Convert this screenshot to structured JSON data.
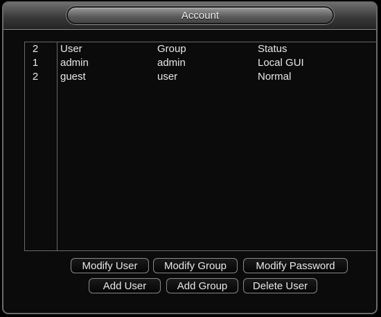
{
  "window": {
    "title": "Account"
  },
  "table": {
    "header": {
      "count": "2",
      "user": "User",
      "group": "Group",
      "status": "Status"
    },
    "rows": [
      {
        "num": "1",
        "user": "admin",
        "group": "admin",
        "status": "Local GUI"
      },
      {
        "num": "2",
        "user": "guest",
        "group": "user",
        "status": "Normal"
      }
    ]
  },
  "buttons": {
    "modify_user": "Modify User",
    "modify_group": "Modify Group",
    "modify_password": "Modify Password",
    "add_user": "Add User",
    "add_group": "Add Group",
    "delete_user": "Delete User"
  },
  "colors": {
    "background": "#0b0b0b",
    "text": "#e8e8e8",
    "border": "#6a6a6a"
  }
}
